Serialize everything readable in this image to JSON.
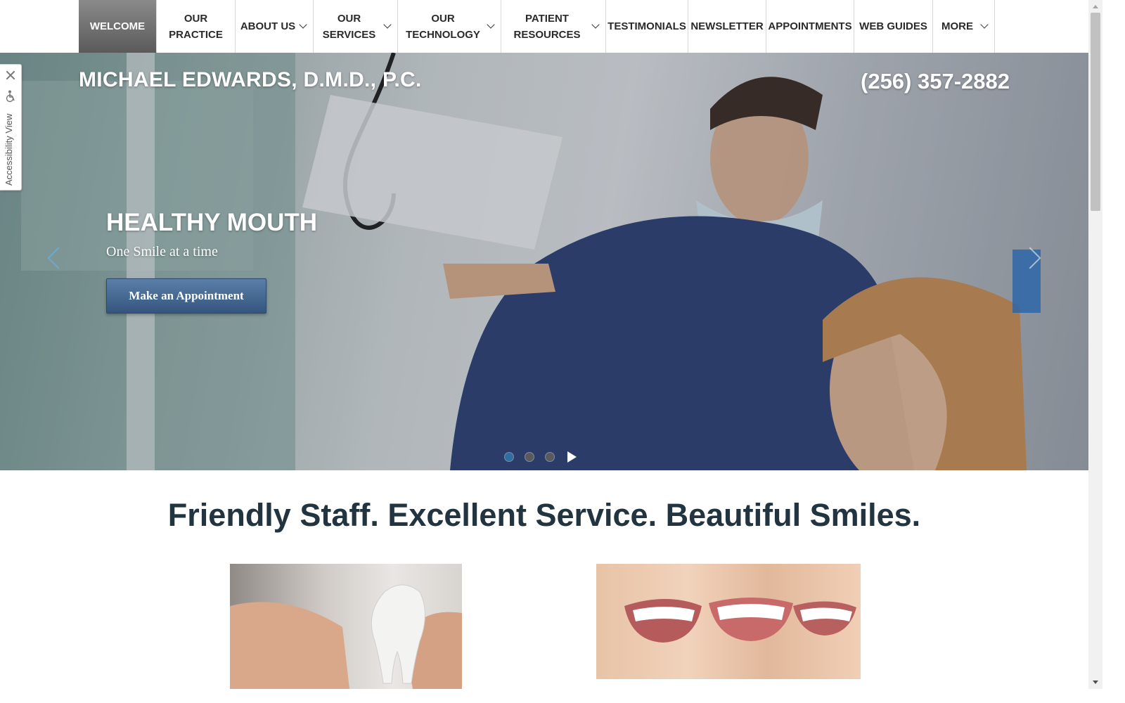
{
  "nav": {
    "items": [
      {
        "label_lines": [
          "WELCOME"
        ],
        "active": true,
        "dropdown": false
      },
      {
        "label_lines": [
          "OUR",
          "PRACTICE"
        ],
        "active": false,
        "dropdown": false
      },
      {
        "label_lines": [
          "ABOUT US"
        ],
        "active": false,
        "dropdown": true
      },
      {
        "label_lines": [
          "OUR",
          "SERVICES"
        ],
        "active": false,
        "dropdown": true
      },
      {
        "label_lines": [
          "OUR",
          "TECHNOLOGY"
        ],
        "active": false,
        "dropdown": true
      },
      {
        "label_lines": [
          "PATIENT",
          "RESOURCES"
        ],
        "active": false,
        "dropdown": true
      },
      {
        "label_lines": [
          "TESTIMONIALS"
        ],
        "active": false,
        "dropdown": false
      },
      {
        "label_lines": [
          "NEWSLETTER"
        ],
        "active": false,
        "dropdown": false
      },
      {
        "label_lines": [
          "APPOINTMENTS"
        ],
        "active": false,
        "dropdown": false
      },
      {
        "label_lines": [
          "WEB GUIDES"
        ],
        "active": false,
        "dropdown": false
      },
      {
        "label_lines": [
          "MORE"
        ],
        "active": false,
        "dropdown": true
      }
    ]
  },
  "header": {
    "practice_name": "MICHAEL EDWARDS, D.M.D., P.C.",
    "phone": "(256) 357-2882"
  },
  "hero": {
    "slide_title": "HEALTHY MOUTH",
    "slide_subtitle": "One Smile at a time",
    "cta_label": "Make an Appointment",
    "slide_count": 3,
    "active_slide": 1
  },
  "accessibility": {
    "label": "Accessibility View",
    "icons": [
      "close-icon",
      "wheelchair-icon"
    ]
  },
  "content": {
    "tagline": "Friendly Staff. Excellent Service. Beautiful Smiles."
  },
  "colors": {
    "nav_active": "#6f6f6f",
    "cta_button": "#3f638d",
    "tagline_text": "#22343f",
    "active_dot": "#2f6ea3"
  }
}
